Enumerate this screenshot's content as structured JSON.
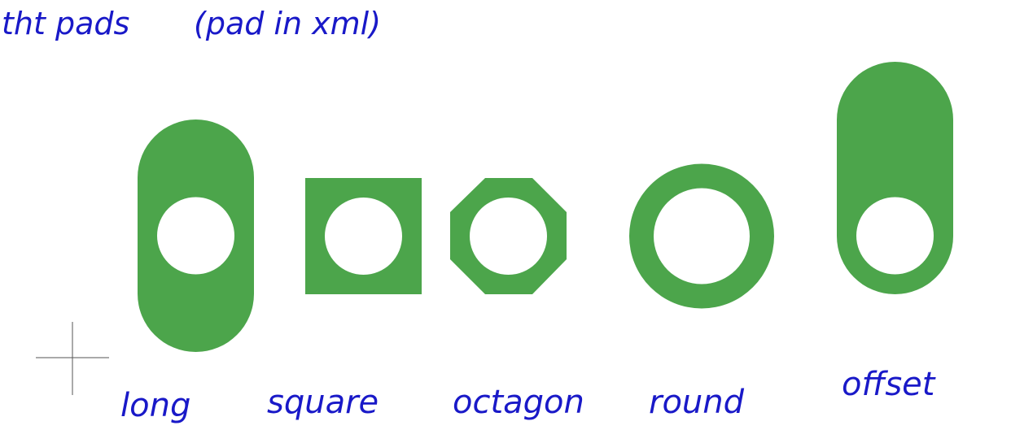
{
  "title": "tht pads",
  "subtitle": "(pad in xml)",
  "colors": {
    "pad": "#4ca54b",
    "ink": "#1919c8",
    "hole": "#ffffff",
    "crosshair": "#555555"
  },
  "pads": [
    {
      "shape": "long",
      "label": "long"
    },
    {
      "shape": "square",
      "label": "square"
    },
    {
      "shape": "octagon",
      "label": "octagon"
    },
    {
      "shape": "round",
      "label": "round"
    },
    {
      "shape": "offset",
      "label": "offset"
    }
  ]
}
